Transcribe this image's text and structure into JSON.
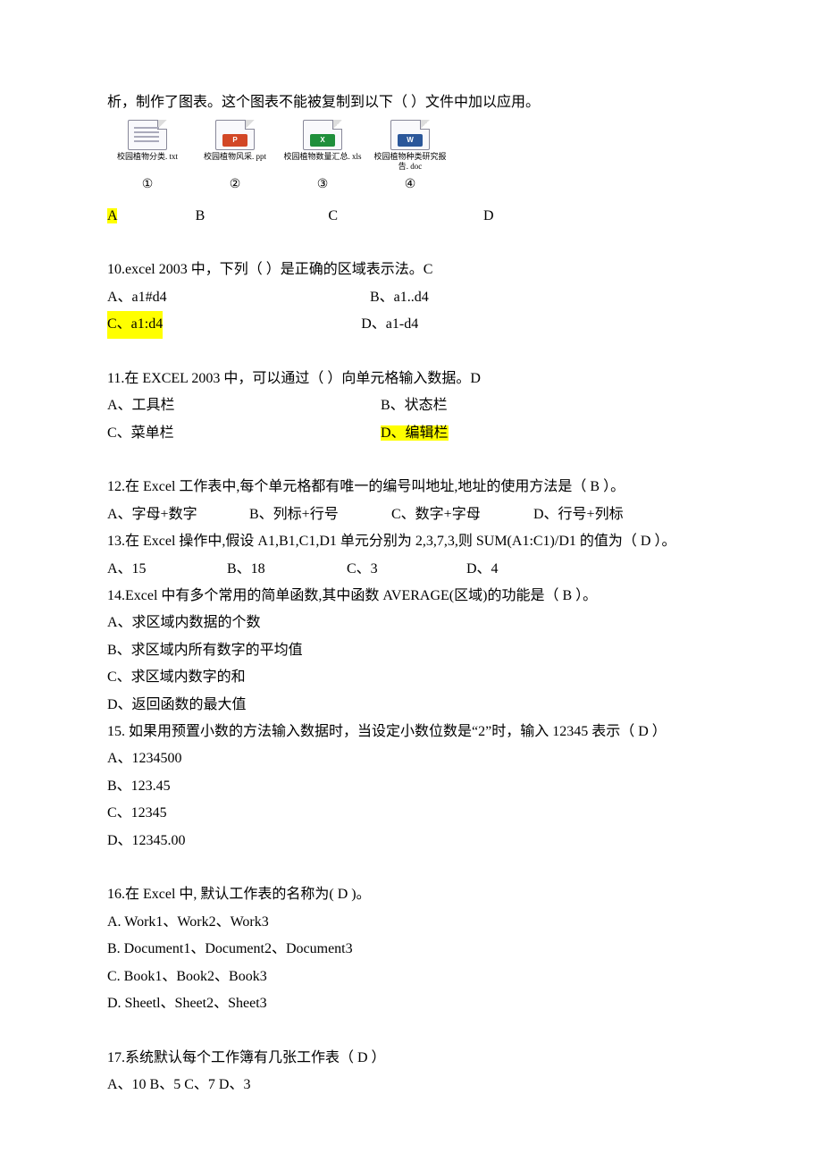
{
  "q9": {
    "intro": "析，制作了图表。这个图表不能被复制到以下（ ）文件中加以应用。",
    "files": [
      {
        "name": "校园植物分类. txt",
        "circ": "①"
      },
      {
        "name": "校园植物风采. ppt",
        "circ": "②"
      },
      {
        "name": "校园植物数量汇总. xls",
        "circ": "③"
      },
      {
        "name": "校园植物种类研究报告. doc",
        "circ": "④"
      }
    ],
    "opts": [
      "A",
      "B",
      "C",
      "D"
    ]
  },
  "q10": {
    "stem": "10.excel 2003 中，下列（  ）是正确的区域表示法。C",
    "a": "A、a1#d4",
    "b": "B、a1..d4",
    "c": "C、a1:d4",
    "d": "D、a1-d4"
  },
  "q11": {
    "stem": "11.在 EXCEL 2003 中，可以通过（ ）向单元格输入数据。D",
    "a": "A、工具栏",
    "b": "B、状态栏",
    "c": "C、菜单栏",
    "d": "D、编辑栏"
  },
  "q12": {
    "stem": "12.在 Excel 工作表中,每个单元格都有唯一的编号叫地址,地址的使用方法是（  B  ）。",
    "a": "A、字母+数字",
    "b": "B、列标+行号",
    "c": "C、数字+字母",
    "d": "D、行号+列标"
  },
  "q13": {
    "stem": "13.在 Excel 操作中,假设 A1,B1,C1,D1 单元分别为 2,3,7,3,则 SUM(A1:C1)/D1 的值为（  D  ）。",
    "a": "A、15",
    "b": "B、18",
    "c": "C、3",
    "d": "D、4"
  },
  "q14": {
    "stem": "14.Excel 中有多个常用的简单函数,其中函数 AVERAGE(区域)的功能是（  B  ）。",
    "a": "A、求区域内数据的个数",
    "b": "B、求区域内所有数字的平均值",
    "c": "C、求区域内数字的和",
    "d": "D、返回函数的最大值"
  },
  "q15": {
    "stem": "15. 如果用预置小数的方法输入数据时，当设定小数位数是“2”时，输入 12345 表示（  D  ）",
    "a": "A、1234500",
    "b": "B、123.45",
    "c": "C、12345",
    "d": "D、12345.00"
  },
  "q16": {
    "stem": "16.在 Excel 中, 默认工作表的名称为( D )。",
    "a": "A.  Work1、Work2、Work3",
    "b": "B.  Document1、Document2、Document3",
    "c": "C.  Book1、Book2、Book3",
    "d": "D.  Sheetl、Sheet2、Sheet3"
  },
  "q17": {
    "stem": "17.系统默认每个工作簿有几张工作表（  D  ）",
    "opts": "A、10    B、5    C、7   D、3"
  }
}
